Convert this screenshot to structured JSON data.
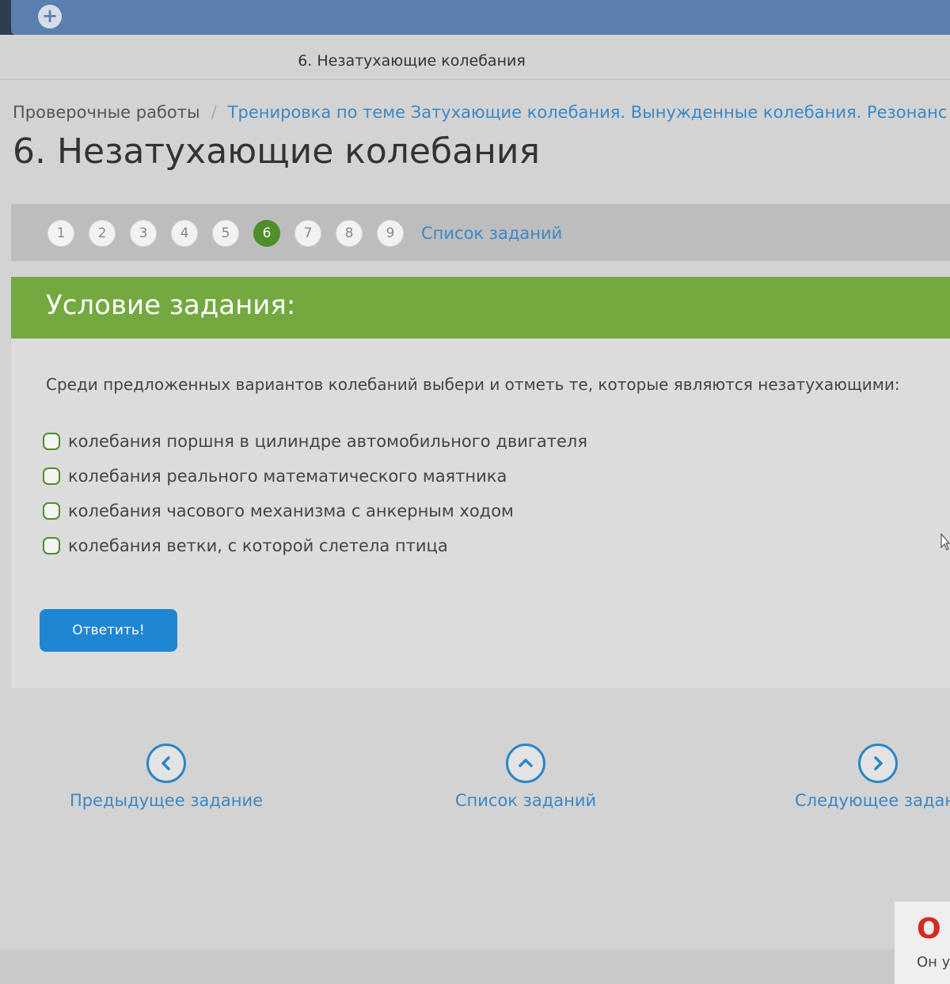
{
  "browser": {
    "new_tab_symbol": "+",
    "tab_title": "6. Незатухающие колебания"
  },
  "breadcrumb": {
    "root": "Проверочные работы",
    "separator": "/",
    "current": "Тренировка по теме Затухающие колебания. Вынужденные колебания. Резонанс"
  },
  "page_title": "6. Незатухающие колебания",
  "pager": {
    "items": [
      "1",
      "2",
      "3",
      "4",
      "5",
      "6",
      "7",
      "8",
      "9"
    ],
    "active": "6",
    "list_link": "Список заданий"
  },
  "task": {
    "header": "Условие задания:",
    "question": "Среди предложенных вариантов колебаний выбери и отметь те, которые являются незатухающими:",
    "options": [
      "колебания поршня в цилиндре автомобильного двигателя",
      "колебания реального математического маятника",
      "колебания часового механизма с анкерным ходом",
      "колебания ветки, с которой слетела птица"
    ],
    "submit_label": "Ответить!"
  },
  "navigation": {
    "prev_label": "Предыдущее задание",
    "list_label": "Список заданий",
    "next_label": "Следующее задани"
  },
  "corner_widget": {
    "logo_letter": "O",
    "text": "Он у"
  },
  "colors": {
    "accent_green": "#73a93f",
    "active_page": "#4f8e2a",
    "link_blue": "#3a88c8",
    "button_blue": "#1f86d3"
  }
}
